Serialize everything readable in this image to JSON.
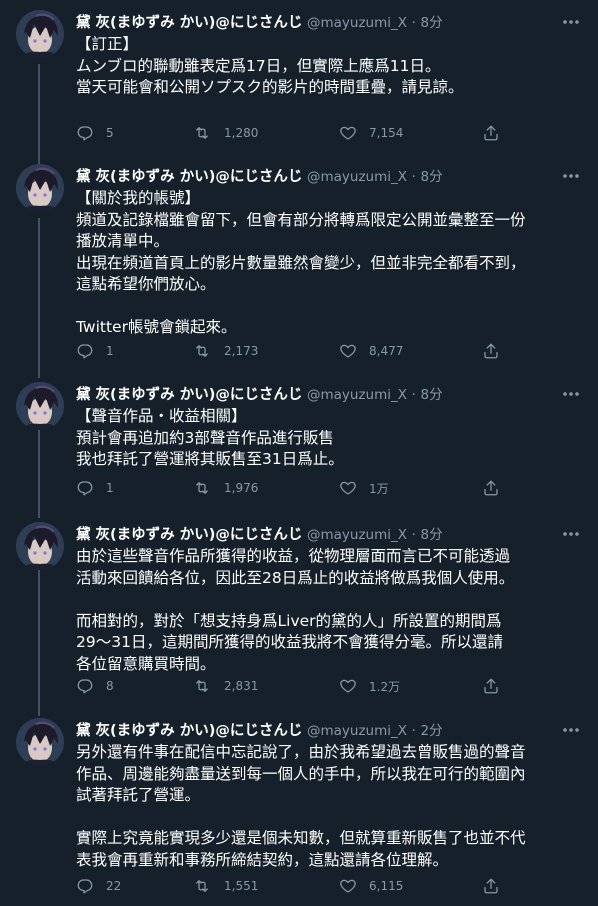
{
  "accent": "#1da1f2",
  "colors": {
    "background": "#15202b",
    "muted": "#8899a6",
    "text": "#ffffff",
    "thread": "#3d5466"
  },
  "tweets": [
    {
      "name": "黛 灰(まゆずみ かい)@にじさんじ",
      "handle": "@mayuzumi_X",
      "dot": "·",
      "time": "8分",
      "lines": [
        "【訂正】",
        "ムンブロ的聯動雖表定爲17日，但實際上應爲11日。",
        "當天可能會和公開ソプスク的影片的時間重疊，請見諒。"
      ],
      "replies": "5",
      "retweets": "1,280",
      "likes": "7,154"
    },
    {
      "name": "黛 灰(まゆずみ かい)@にじさんじ",
      "handle": "@mayuzumi_X",
      "dot": "·",
      "time": "8分",
      "lines": [
        "【關於我的帳號】",
        "頻道及記錄檔雖會留下，但會有部分將轉爲限定公開並彙整至一份",
        "播放清單中。",
        "出現在頻道首頁上的影片數量雖然會變少，但並非完全都看不到，",
        "這點希望你們放心。",
        "",
        "Twitter帳號會鎖起來。"
      ],
      "replies": "1",
      "retweets": "2,173",
      "likes": "8,477"
    },
    {
      "name": "黛 灰(まゆずみ かい)@にじさんじ",
      "handle": "@mayuzumi_X",
      "dot": "·",
      "time": "8分",
      "lines": [
        "【聲音作品・收益相關】",
        "預計會再追加約3部聲音作品進行販售",
        "我也拜託了營運將其販售至31日爲止。"
      ],
      "replies": "1",
      "retweets": "1,976",
      "likes": "1万"
    },
    {
      "name": "黛 灰(まゆずみ かい)@にじさんじ",
      "handle": "@mayuzumi_X",
      "dot": "·",
      "time": "8分",
      "lines": [
        "由於這些聲音作品所獲得的收益，從物理層面而言已不可能透過",
        "活動來回饋給各位，因此至28日爲止的收益將做爲我個人使用。",
        "",
        "而相對的，對於「想支持身爲Liver的黛的人」所設置的期間爲",
        "29〜31日，這期間所獲得的收益我將不會獲得分毫。所以還請",
        "各位留意購買時間。"
      ],
      "replies": "8",
      "retweets": "2,831",
      "likes": "1.2万"
    },
    {
      "name": "黛 灰(まゆずみ かい)@にじさんじ",
      "handle": "@mayuzumi_X",
      "dot": "·",
      "time": "2分",
      "lines": [
        "另外還有件事在配信中忘記說了，由於我希望過去曾販售過的聲音",
        "作品、周邊能夠盡量送到每一個人的手中，所以我在可行的範圍內",
        "試著拜託了營運。",
        "",
        "實際上究竟能實現多少還是個未知數，但就算重新販售了也並不代",
        "表我會再重新和事務所締結契約，這點還請各位理解。"
      ],
      "replies": "22",
      "retweets": "1,551",
      "likes": "6,115"
    }
  ]
}
